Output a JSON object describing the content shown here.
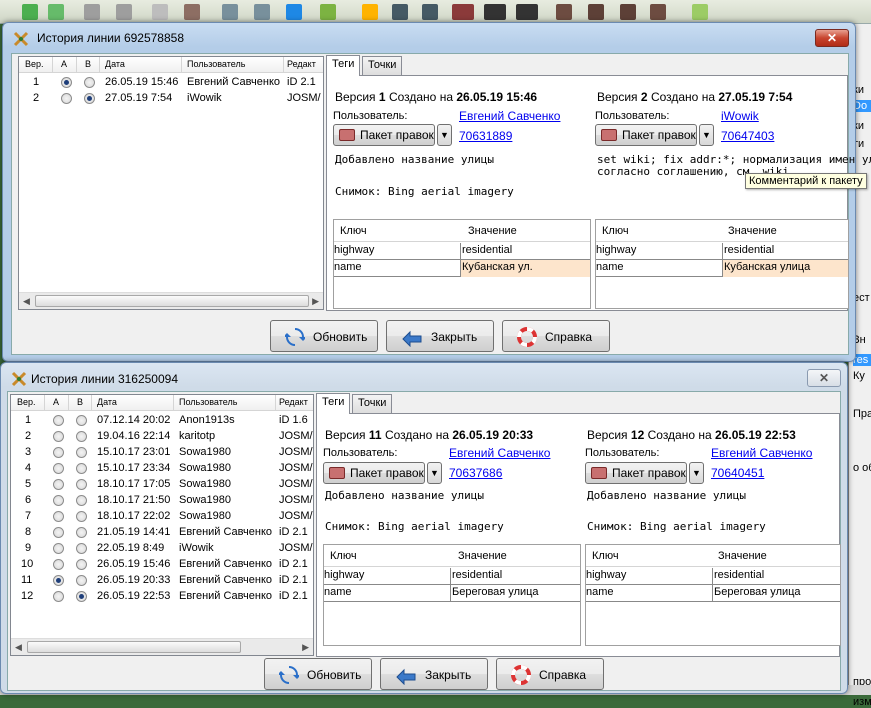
{
  "window1": {
    "title": "История линии 692578858",
    "close": "✕",
    "list": {
      "headers": [
        "Вер.",
        "A",
        "B",
        "Дата",
        "Пользователь",
        "Редакт"
      ],
      "rows": [
        {
          "ver": "1",
          "a": true,
          "b": false,
          "date": "26.05.19 15:46",
          "user": "Евгений Савченко",
          "editor": "iD 2.1"
        },
        {
          "ver": "2",
          "a": false,
          "b": true,
          "date": "27.05.19 7:54",
          "user": "iWowik",
          "editor": "JOSM/"
        }
      ]
    },
    "tabs": [
      "Теги",
      "Точки"
    ],
    "left": {
      "prefix": "Версия",
      "num": "1",
      "created": "Создано на",
      "ts": "26.05.19 15:46",
      "user_label": "Пользователь:",
      "user": "Евгений Савченко",
      "changeset_btn": "Пакет правок",
      "changeset": "70631889",
      "comment": "Добавлено название улицы",
      "source": "Снимок: Bing aerial imagery",
      "kv_headers": [
        "Ключ",
        "Значение"
      ],
      "kv": [
        {
          "k": "highway",
          "v": "residential"
        },
        {
          "k": "name",
          "v": "Кубанская ул."
        }
      ]
    },
    "right": {
      "prefix": "Версия",
      "num": "2",
      "created": "Создано на",
      "ts": "27.05.19 7:54",
      "user_label": "Пользователь:",
      "user": "iWowik",
      "changeset_btn": "Пакет правок",
      "changeset": "70647403",
      "comment": "set wiki; fix addr:*; нормализация имен улиц",
      "comment2": "согласно соглашению, см. wiki",
      "kv_headers": [
        "Ключ",
        "Значение"
      ],
      "kv": [
        {
          "k": "highway",
          "v": "residential"
        },
        {
          "k": "name",
          "v": "Кубанская улица"
        }
      ]
    },
    "buttons": {
      "refresh": "Обновить",
      "close": "Закрыть",
      "help": "Справка"
    },
    "tooltip": "Комментарий к пакету"
  },
  "window2": {
    "title": "История линии 316250094",
    "close": "✕",
    "list": {
      "headers": [
        "Вер.",
        "A",
        "B",
        "Дата",
        "Пользователь",
        "Редакт"
      ],
      "rows": [
        {
          "ver": "1",
          "a": false,
          "b": false,
          "date": "07.12.14 20:02",
          "user": "Anon1913s",
          "editor": "iD 1.6"
        },
        {
          "ver": "2",
          "a": false,
          "b": false,
          "date": "19.04.16 22:14",
          "user": "karitotp",
          "editor": "JOSM/"
        },
        {
          "ver": "3",
          "a": false,
          "b": false,
          "date": "15.10.17 23:01",
          "user": "Sowa1980",
          "editor": "JOSM/"
        },
        {
          "ver": "4",
          "a": false,
          "b": false,
          "date": "15.10.17 23:34",
          "user": "Sowa1980",
          "editor": "JOSM/"
        },
        {
          "ver": "5",
          "a": false,
          "b": false,
          "date": "18.10.17 17:05",
          "user": "Sowa1980",
          "editor": "JOSM/"
        },
        {
          "ver": "6",
          "a": false,
          "b": false,
          "date": "18.10.17 21:50",
          "user": "Sowa1980",
          "editor": "JOSM/"
        },
        {
          "ver": "7",
          "a": false,
          "b": false,
          "date": "18.10.17 22:02",
          "user": "Sowa1980",
          "editor": "JOSM/"
        },
        {
          "ver": "8",
          "a": false,
          "b": false,
          "date": "21.05.19 14:41",
          "user": "Евгений Савченко",
          "editor": "iD 2.1"
        },
        {
          "ver": "9",
          "a": false,
          "b": false,
          "date": "22.05.19 8:49",
          "user": "iWowik",
          "editor": "JOSM/"
        },
        {
          "ver": "10",
          "a": false,
          "b": false,
          "date": "26.05.19 15:46",
          "user": "Евгений Савченко",
          "editor": "iD 2.1"
        },
        {
          "ver": "11",
          "a": true,
          "b": false,
          "date": "26.05.19 20:33",
          "user": "Евгений Савченко",
          "editor": "iD 2.1"
        },
        {
          "ver": "12",
          "a": false,
          "b": true,
          "date": "26.05.19 22:53",
          "user": "Евгений Савченко",
          "editor": "iD 2.1"
        }
      ]
    },
    "tabs": [
      "Теги",
      "Точки"
    ],
    "left": {
      "prefix": "Версия",
      "num": "11",
      "created": "Создано на",
      "ts": "26.05.19 20:33",
      "user_label": "Пользователь:",
      "user": "Евгений Савченко",
      "changeset_btn": "Пакет правок",
      "changeset": "70637686",
      "comment": "Добавлено название улицы",
      "source": "Снимок: Bing aerial imagery",
      "kv_headers": [
        "Ключ",
        "Значение"
      ],
      "kv": [
        {
          "k": "highway",
          "v": "residential"
        },
        {
          "k": "name",
          "v": "Береговая улица"
        }
      ]
    },
    "right": {
      "prefix": "Версия",
      "num": "12",
      "created": "Создано на",
      "ts": "26.05.19 22:53",
      "user_label": "Пользователь:",
      "user": "Евгений Савченко",
      "changeset_btn": "Пакет правок",
      "changeset": "70640451",
      "comment": "Добавлено название улицы",
      "source": "Снимок: Bing aerial imagery",
      "kv_headers": [
        "Ключ",
        "Значение"
      ],
      "kv": [
        {
          "k": "highway",
          "v": "residential"
        },
        {
          "k": "name",
          "v": "Береговая улица"
        }
      ]
    },
    "buttons": {
      "refresh": "Обновить",
      "close": "Закрыть",
      "help": "Справка"
    }
  },
  "background": {
    "right_strip": [
      "ки",
      "Do",
      "ки",
      "ти",
      "ест",
      "Зн",
      "res",
      "Ку",
      "Прав",
      "о об",
      "пров",
      "измен"
    ]
  },
  "colors": {
    "link": "#0000ee",
    "diff": "#fde5cc",
    "close_red": "#c8452f",
    "title_bg": "#b4cde8"
  }
}
